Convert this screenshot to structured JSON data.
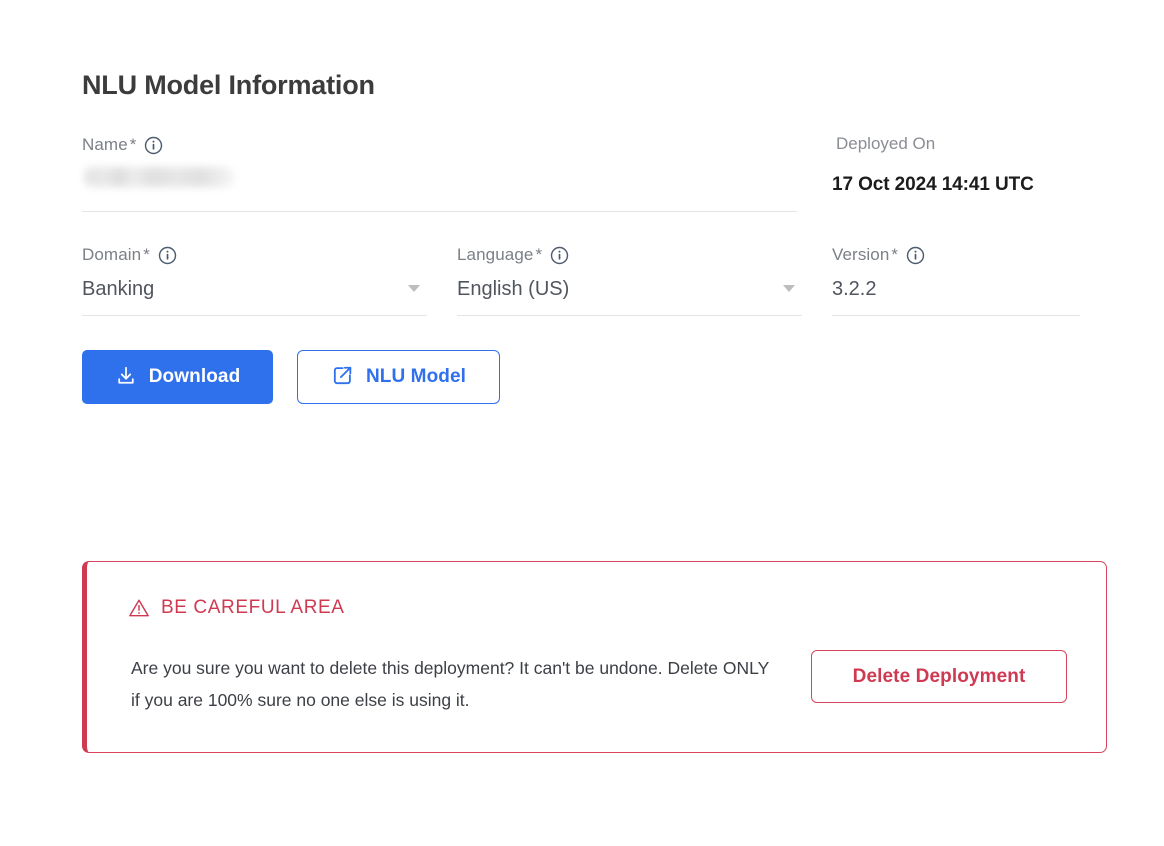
{
  "page": {
    "title": "NLU Model Information"
  },
  "fields": {
    "name": {
      "label": "Name",
      "required_marker": "*",
      "info_icon": "info-circle-icon",
      "value": "",
      "redacted": true
    },
    "domain": {
      "label": "Domain",
      "required_marker": "*",
      "info_icon": "info-circle-icon",
      "value": "Banking",
      "caret_icon": "caret-down-icon"
    },
    "language": {
      "label": "Language",
      "required_marker": "*",
      "info_icon": "info-circle-icon",
      "value": "English (US)",
      "caret_icon": "caret-down-icon"
    },
    "version": {
      "label": "Version",
      "required_marker": "*",
      "info_icon": "info-circle-icon",
      "value": "3.2.2"
    },
    "deployed_on": {
      "label": "Deployed On",
      "value": "17 Oct 2024 14:41 UTC"
    }
  },
  "actions": {
    "download": {
      "label": "Download",
      "icon": "download-icon"
    },
    "nlu_model": {
      "label": "NLU Model",
      "icon": "external-link-icon"
    }
  },
  "danger_zone": {
    "icon": "warning-triangle-icon",
    "title": "BE CAREFUL AREA",
    "message": "Are you sure you want to delete this deployment? It can't be undone. Delete ONLY if you are 100% sure no one else is using it.",
    "delete_button_label": "Delete Deployment"
  },
  "colors": {
    "primary": "#2f71ed",
    "danger": "#cf3a52",
    "danger_border": "#d9445c",
    "label_gray": "#7b7f87",
    "value_gray": "#51555e",
    "title_gray": "#3c3c3c",
    "underline": "#e3e4e6"
  }
}
